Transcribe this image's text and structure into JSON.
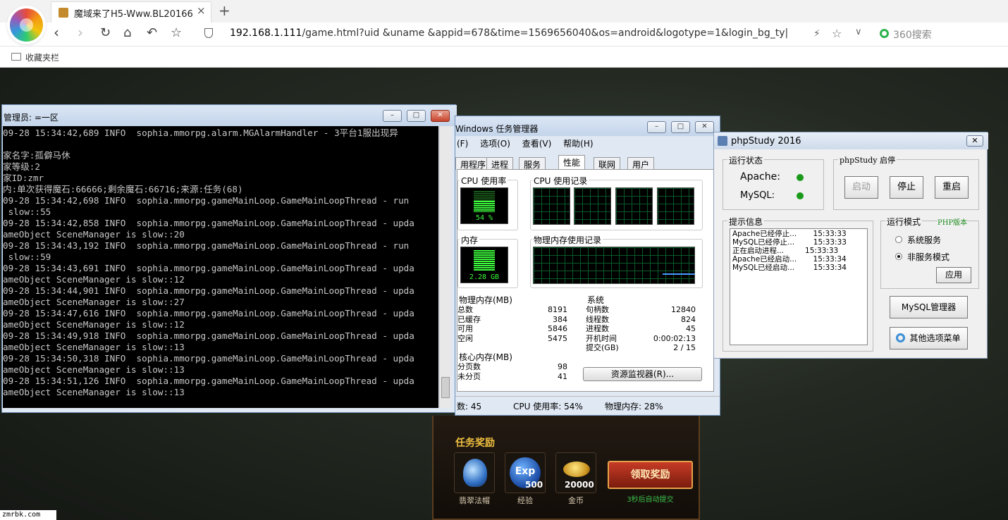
{
  "browser": {
    "tab_title": "魔域来了H5-Www.BL20166.Co",
    "tab_close": "×",
    "tab_new": "+",
    "address_host": "192.168.1.111",
    "address_rest": "/game.html?uid      &uname      &appid=678&time=1569656040&os=android&logotype=1&login_bg_ty|",
    "search_label": "360搜索",
    "bookmarks_label": "收藏夹栏",
    "icons": [
      "back-icon",
      "forward-icon",
      "reload-icon",
      "home-icon",
      "undo-icon",
      "star-icon",
      "shield-icon",
      "lightning-icon"
    ]
  },
  "console": {
    "title": "管理员: =一区",
    "lines": [
      "09-28 15:34:42,689 INFO  sophia.mmorpg.alarm.MGAlarmHandler - 3平台1服出现异",
      "",
      "家名字:孤僻马休",
      "家等级:2",
      "家ID:zmr",
      "内:单次获得魔石:66666;剩余魔石:66716;来源:任务(68)",
      "09-28 15:34:42,698 INFO  sophia.mmorpg.gameMainLoop.GameMainLoopThread - run",
      " slow::55",
      "09-28 15:34:42,858 INFO  sophia.mmorpg.gameMainLoop.GameMainLoopThread - upda",
      "ameObject SceneManager is slow::20",
      "09-28 15:34:43,192 INFO  sophia.mmorpg.gameMainLoop.GameMainLoopThread - run",
      " slow::59",
      "09-28 15:34:43,691 INFO  sophia.mmorpg.gameMainLoop.GameMainLoopThread - upda",
      "ameObject SceneManager is slow::12",
      "09-28 15:34:44,901 INFO  sophia.mmorpg.gameMainLoop.GameMainLoopThread - upda",
      "ameObject SceneManager is slow::27",
      "09-28 15:34:47,616 INFO  sophia.mmorpg.gameMainLoop.GameMainLoopThread - upda",
      "ameObject SceneManager is slow::12",
      "09-28 15:34:49,918 INFO  sophia.mmorpg.gameMainLoop.GameMainLoopThread - upda",
      "ameObject SceneManager is slow::13",
      "09-28 15:34:50,318 INFO  sophia.mmorpg.gameMainLoop.GameMainLoopThread - upda",
      "ameObject SceneManager is slow::13",
      "09-28 15:34:51,126 INFO  sophia.mmorpg.gameMainLoop.GameMainLoopThread - upda",
      "ameObject SceneManager is slow::13"
    ]
  },
  "taskmgr": {
    "title": "Windows 任务管理器",
    "menu": [
      "(F)",
      "选项(O)",
      "查看(V)",
      "帮助(H)"
    ],
    "tabs": [
      "用程序",
      "进程",
      "服务",
      "性能",
      "联网",
      "用户"
    ],
    "cpu_label": "CPU 使用率",
    "cpu_value": "54 %",
    "cpu_hist_label": "CPU 使用记录",
    "mem_label": "内存",
    "mem_value": "2.28 GB",
    "mem_hist_label": "物理内存使用记录",
    "phys_title": "物理内存(MB)",
    "phys": [
      [
        "总数",
        "8191"
      ],
      [
        "已缓存",
        "384"
      ],
      [
        "可用",
        "5846"
      ],
      [
        "空闲",
        "5475"
      ]
    ],
    "kernel_title": "核心内存(MB)",
    "kernel": [
      [
        "分页数",
        "98"
      ],
      [
        "未分页",
        "41"
      ]
    ],
    "sys_title": "系统",
    "sys": [
      [
        "句柄数",
        "12840"
      ],
      [
        "线程数",
        "824"
      ],
      [
        "进程数",
        "45"
      ],
      [
        "开机时间",
        "0:00:02:13"
      ],
      [
        "提交(GB)",
        "2 / 15"
      ]
    ],
    "resource_button": "资源监视器(R)...",
    "status_procs": "数: 45",
    "status_cpu": "CPU 使用率: 54%",
    "status_mem": "物理内存: 28%"
  },
  "phpstudy": {
    "title": "phpStudy 2016",
    "close": "✕",
    "status_title": "运行状态",
    "apache_label": "Apache:",
    "mysql_label": "MySQL:",
    "startstop_title": "phpStudy 启停",
    "btn_start": "启动",
    "btn_stop": "停止",
    "btn_restart": "重启",
    "info_title": "提示信息",
    "info_lines": [
      "Apache已经停止...       15:33:33",
      "MySQL已经停止...        15:33:33",
      "正在启动进程...         15:33:33",
      "Apache已经启动...       15:33:34",
      "MySQL已经启动...        15:33:34"
    ],
    "mode_title": "运行模式",
    "php_version": "PHP版本",
    "mode_system": "系统服务",
    "mode_nonservice": "非服务模式",
    "btn_apply": "应用",
    "btn_mysql_admin": "MySQL管理器",
    "btn_other": "其他选项菜单"
  },
  "reward": {
    "title": "任务奖励",
    "items": [
      {
        "label": "翡翠法帽",
        "badge": ""
      },
      {
        "label": "经验",
        "badge": "500"
      },
      {
        "label": "金币",
        "badge": "20000"
      }
    ],
    "exp_text": "Exp",
    "claim_button": "领取奖励",
    "auto_text": "3秒后自动提交"
  },
  "watermark": "zmrbk.com"
}
